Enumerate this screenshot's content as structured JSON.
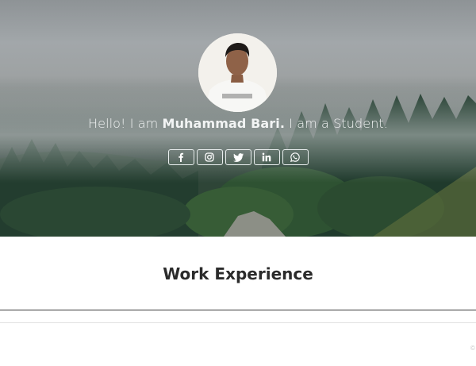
{
  "hero": {
    "greeting": "Hello! I am ",
    "name": "Muhammad Bari.",
    "suffix": " I am a Student."
  },
  "socials": [
    {
      "name": "facebook",
      "icon": "facebook-icon"
    },
    {
      "name": "instagram",
      "icon": "instagram-icon"
    },
    {
      "name": "twitter",
      "icon": "twitter-icon"
    },
    {
      "name": "linkedin",
      "icon": "linkedin-icon"
    },
    {
      "name": "whatsapp",
      "icon": "whatsapp-icon"
    }
  ],
  "section": {
    "title": "Work Experience"
  },
  "colors": {
    "hero_text": "#f2f4f4",
    "title_text": "#2b2b2b",
    "divider": "#3a3a3a"
  },
  "footer": {
    "corner_text": "©"
  }
}
